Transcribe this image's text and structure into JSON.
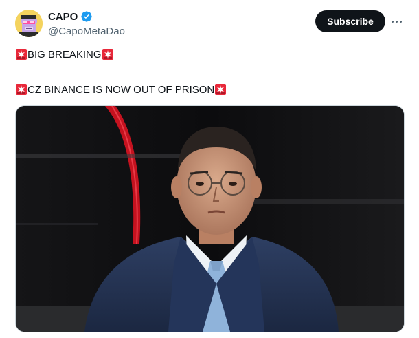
{
  "author": {
    "display_name": "CAPO",
    "handle": "@CapoMetaDao",
    "verified": true,
    "avatar_icon": "pixel-ape-avatar-icon"
  },
  "actions": {
    "subscribe_label": "Subscribe",
    "more_icon": "more-dots-icon"
  },
  "tweet": {
    "line1_text": "BIG BREAKING",
    "line2_text": "CZ BINANCE IS NOW OUT OF PRISON",
    "emoji": "rotating-light-icon"
  },
  "media": {
    "type": "photo",
    "subject": "man in navy suit and glasses"
  },
  "colors": {
    "text": "#0f1419",
    "secondary": "#536471",
    "verified_blue": "#1d9bf0",
    "button_bg": "#0f1419",
    "siren_red": "#e8283a"
  }
}
